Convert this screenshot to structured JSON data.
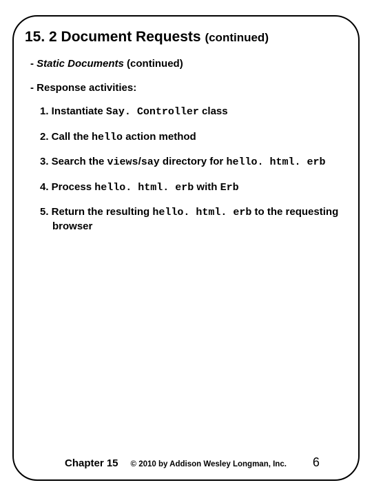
{
  "title": {
    "main": "15. 2 Document Requests",
    "continued": "(continued)"
  },
  "sub1": {
    "dash": "- ",
    "italic": "Static Documents",
    "rest": " (continued)"
  },
  "sub2": "- Response activities:",
  "items": {
    "i1": {
      "pre": "1. Instantiate ",
      "code": "Say. Controller",
      "post": " class"
    },
    "i2": {
      "pre": "2. Call the ",
      "code": "hello",
      "post": " action method"
    },
    "i3": {
      "pre": "3. Search the ",
      "code1": "views",
      "mid": "/",
      "code2": "say",
      "post1": " directory for ",
      "code3": "hello. html. erb",
      "post2": ""
    },
    "i4": {
      "pre": "4. Process ",
      "code": "hello. html. erb",
      "mid": " with ",
      "code2": "Erb"
    },
    "i5": {
      "pre": "5. Return the resulting ",
      "code": "hello. html. erb",
      "post": " to the requesting browser"
    }
  },
  "footer": {
    "chapter": "Chapter 15",
    "copyright": "© 2010 by Addison Wesley Longman, Inc.",
    "page": "6"
  }
}
